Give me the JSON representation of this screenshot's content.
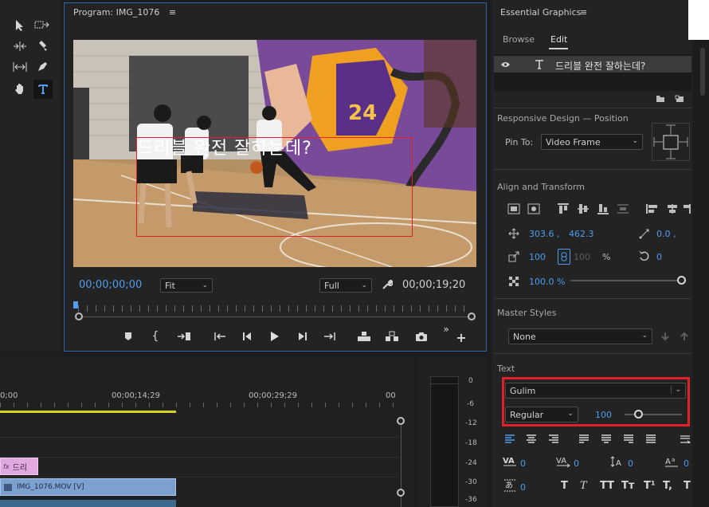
{
  "program_monitor": {
    "tab_title": "Program: IMG_1076",
    "overlay_caption": "드리블 완전 잘하는데?",
    "timecode_current": "00;00;00;00",
    "fit_value": "Fit",
    "quality_value": "Full",
    "timecode_duration": "00;00;19;20",
    "jersey_number": "24"
  },
  "timeline": {
    "ruler": [
      "0;00",
      "00;00;14;29",
      "00;00;29;29",
      "00"
    ],
    "clips": {
      "graphic_label": "드리",
      "graphic_fx": "fx",
      "video_label": "IMG_1076.MOV [V]"
    }
  },
  "audio_meter": {
    "labels": [
      "0",
      "-6",
      "-12",
      "-18",
      "-24",
      "-30",
      "-36"
    ]
  },
  "essential_graphics": {
    "title": "Essential Graphics",
    "tabs": [
      "Browse",
      "Edit"
    ],
    "layer_name": "드리블 완전 잘하는데?",
    "responsive": {
      "title": "Responsive Design — Position",
      "pin_label": "Pin To:",
      "pin_value": "Video Frame"
    },
    "align": {
      "title": "Align and Transform",
      "pos_x": "303.6 ,",
      "pos_y": "462.3",
      "rotation_x": "0.0 ,",
      "scale": "100",
      "scale_locked": "100",
      "scale_unit": "%",
      "rotation": "0",
      "opacity": "100.0 %",
      "opacity_level": 1.0
    },
    "master_styles": {
      "title": "Master Styles",
      "value": "None"
    },
    "text": {
      "title": "Text",
      "font": "Gulim",
      "style": "Regular",
      "size": "100",
      "size_level": 0.2,
      "tracking": "0",
      "kerning": "0",
      "leading": "0",
      "baseline": "0",
      "tsume": "0",
      "style_buttons": [
        "T",
        "T",
        "TT",
        "Tт",
        "T¹",
        "T,",
        "T"
      ]
    },
    "colors": {
      "accent": "#4f9cf0",
      "highlight": "#e0202a"
    }
  }
}
